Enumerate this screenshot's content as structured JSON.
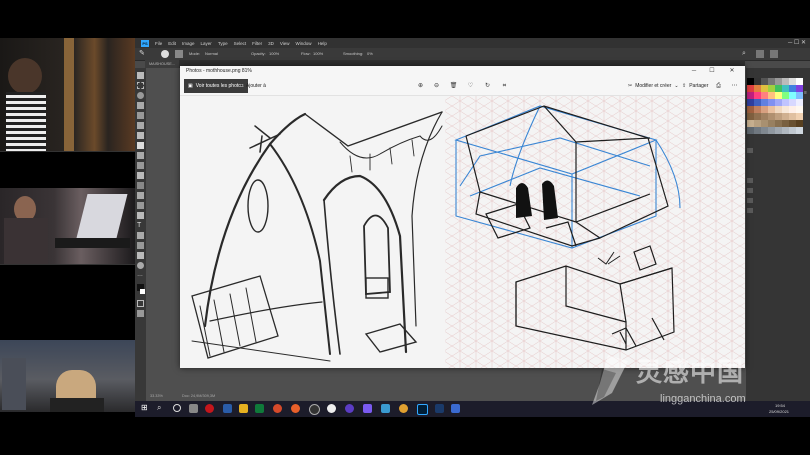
{
  "photoshop": {
    "menu": [
      "PS",
      "File",
      "Edit",
      "Image",
      "Layer",
      "Type",
      "Select",
      "Filter",
      "3D",
      "View",
      "Window",
      "Help"
    ],
    "options": {
      "mode_label": "Mode:",
      "mode_value": "Normal",
      "opacity_label": "Opacity:",
      "opacity_value": "100%",
      "flow_label": "Flow:",
      "flow_value": "100%",
      "smoothing_label": "Smoothing:",
      "smoothing_value": "0%"
    },
    "doc_tab": "MAISHOUSE...",
    "status": {
      "zoom": "33.33%",
      "doc": "Doc: 24,9M/309,3M"
    }
  },
  "photo_viewer": {
    "title": "Photos - mothhouse.png",
    "zoom": "81%",
    "see_all": "Voir toutes les photos",
    "add_to": "Ajouter à",
    "edit_create": "Modifier et créer",
    "share": "Partager",
    "icons": [
      "zoom-in-icon",
      "zoom-out-icon",
      "delete-icon",
      "favorite-icon",
      "rotate-icon",
      "crop-icon",
      "print-icon",
      "more-icon"
    ]
  },
  "taskbar": {
    "time": "19:54",
    "date": "25/09/2021"
  },
  "watermark": {
    "text": "灵感中国",
    "url": "lingganchina.com"
  },
  "colors": {
    "ps_bg": "#4a4a4a",
    "accent_blue": "#3a86d4",
    "sketch_ink": "#2a2a2a",
    "grid": "#e6c6c6"
  }
}
